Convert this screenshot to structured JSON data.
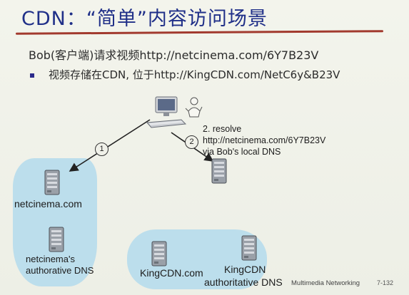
{
  "title": "CDN：“简单”内容访问场景",
  "bullets": {
    "line1": "Bob(客户端)请求视频http://netcinema.com/6Y7B23V",
    "line2": "视频存储在CDN, 位于http://KingCDN.com/NetC6y&B23V"
  },
  "diagram": {
    "step1": {
      "number": "1"
    },
    "step2": {
      "number": "2",
      "line1": "2. resolve",
      "line2": "http://netcinema.com/6Y7B23V",
      "line3": "via Bob's local DNS"
    },
    "nodes": {
      "netcinema_server": "netcinema.com",
      "netcinema_dns_line1": "netcinema's",
      "netcinema_dns_line2": "authorative DNS",
      "kingcdn_server": "KingCDN.com",
      "kingcdn_dns_line1": "KingCDN",
      "kingcdn_dns_line2": "authoritative DNS"
    }
  },
  "footer": {
    "course": "Multimedia Networking",
    "page": "7-132"
  },
  "colors": {
    "title": "#1f2f88",
    "title_rule": "#a23a2e",
    "highlight": "#b6dcec"
  }
}
